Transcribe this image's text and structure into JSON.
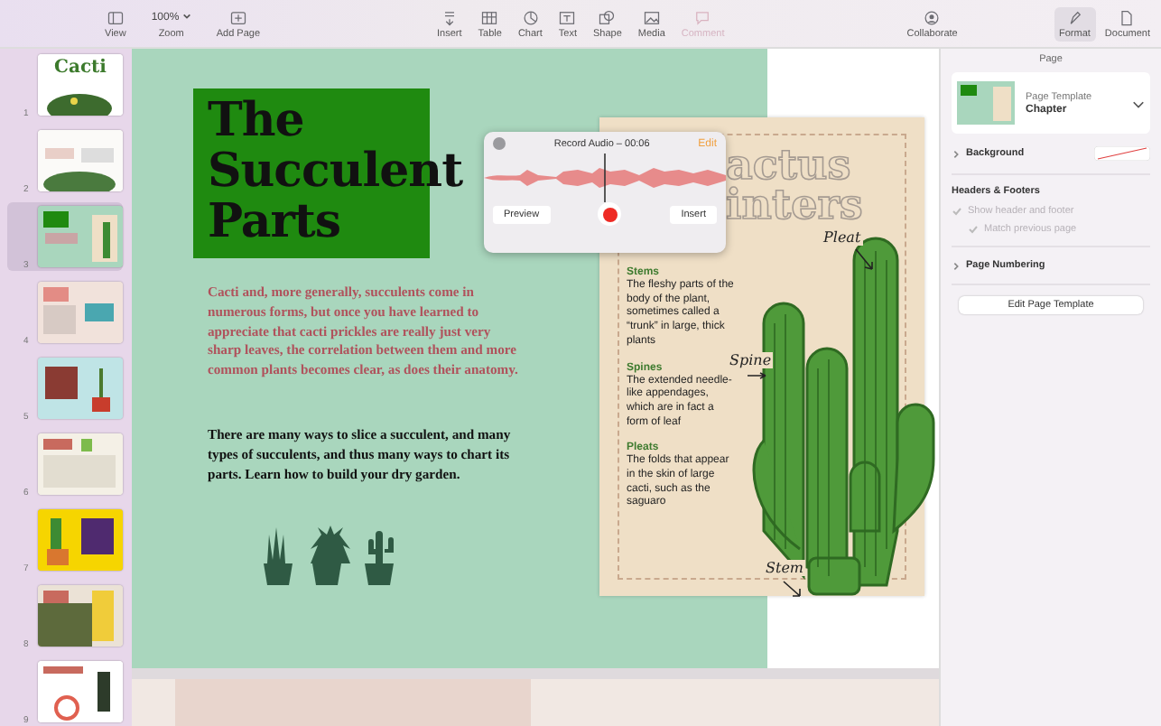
{
  "toolbar": {
    "left": [
      {
        "label": "View",
        "selected": false
      },
      {
        "label": "Zoom",
        "value": "100%",
        "selected": false
      },
      {
        "label": "Add Page",
        "selected": false
      }
    ],
    "middle": [
      {
        "label": "Insert",
        "disabled": false
      },
      {
        "label": "Table",
        "disabled": false
      },
      {
        "label": "Chart",
        "disabled": false
      },
      {
        "label": "Text",
        "disabled": false
      },
      {
        "label": "Shape",
        "disabled": false
      },
      {
        "label": "Media",
        "disabled": false
      },
      {
        "label": "Comment",
        "disabled": true
      }
    ],
    "collaborate": {
      "label": "Collaborate"
    },
    "right": [
      {
        "label": "Format",
        "selected": true
      },
      {
        "label": "Document",
        "selected": false
      }
    ]
  },
  "sidebar": {
    "pages": [
      {
        "number": "1",
        "selected": false,
        "color": "#ffffff",
        "title": "Cacti"
      },
      {
        "number": "2",
        "selected": false,
        "color": "#fbfaf8"
      },
      {
        "number": "3",
        "selected": true,
        "color": "#a9d6bd"
      },
      {
        "number": "4",
        "selected": false,
        "color": "#f1e2db"
      },
      {
        "number": "5",
        "selected": false,
        "color": "#bfe4e6"
      },
      {
        "number": "6",
        "selected": false,
        "color": "#f4f0e6"
      },
      {
        "number": "7",
        "selected": false,
        "color": "#f6d500"
      },
      {
        "number": "8",
        "selected": false,
        "color": "#ebe2d6"
      },
      {
        "number": "9",
        "selected": false,
        "color": "#ffffff"
      }
    ]
  },
  "page": {
    "title": "The Succulent Parts",
    "intro": "Cacti and, more generally, succulents come in numerous forms, but once you have learned to appreciate that cacti prickles are really just very sharp leaves, the correlation between them and more common plants becomes clear, as does their anatomy.",
    "body": "There are many ways to slice a succulent, and many types of succulents, and thus many ways to chart its parts. Learn how to build your dry garden.",
    "card": {
      "title_lines": [
        "actus",
        "inters"
      ],
      "sections": [
        {
          "heading": "Stems",
          "text": "The fleshy parts of the body of the plant, sometimes called a “trunk” in large, thick plants"
        },
        {
          "heading": "Spines",
          "text": "The extended needle-like appendages, which are in fact a form of leaf"
        },
        {
          "heading": "Pleats",
          "text": "The folds that appear in the skin of large cacti, such as the saguaro"
        }
      ],
      "labels": [
        "Pleat",
        "Spine",
        "Stem"
      ]
    }
  },
  "record_popup": {
    "title": "Record Audio – 00:06",
    "edit": "Edit",
    "preview": "Preview",
    "insert": "Insert"
  },
  "inspector": {
    "title": "Page",
    "template_label": "Page Template",
    "template_name": "Chapter",
    "background": {
      "label": "Background",
      "expanded": false
    },
    "headers_title": "Headers & Footers",
    "options": [
      {
        "label": "Show header and footer",
        "checked": true,
        "disabled": true
      },
      {
        "label": "Match previous page",
        "checked": true,
        "disabled": true
      }
    ],
    "page_numbering": {
      "label": "Page Numbering",
      "expanded": false
    },
    "edit_button": "Edit Page Template"
  }
}
